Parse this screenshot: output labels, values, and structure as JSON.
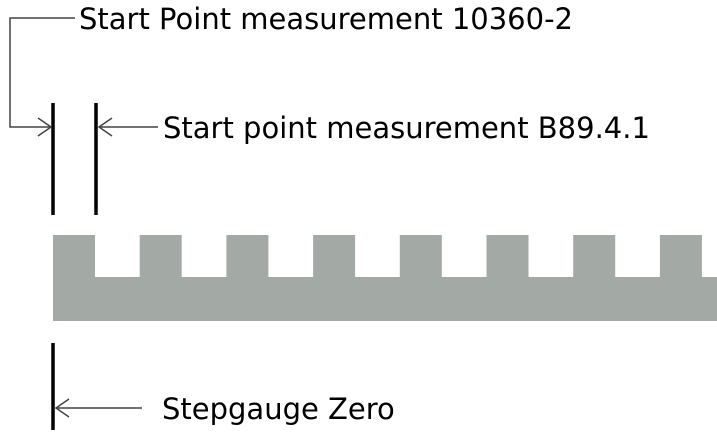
{
  "labels": {
    "start_point_10360": "Start Point measurement 10360-2",
    "start_point_b89": "Start point measurement B89.4.1",
    "stepgauge_zero": "Stepgauge Zero"
  },
  "colors": {
    "gauge_fill": "#a3aaa6",
    "line": "#000000",
    "background": "#ffffff"
  },
  "gauge": {
    "tooth_count": 8
  }
}
